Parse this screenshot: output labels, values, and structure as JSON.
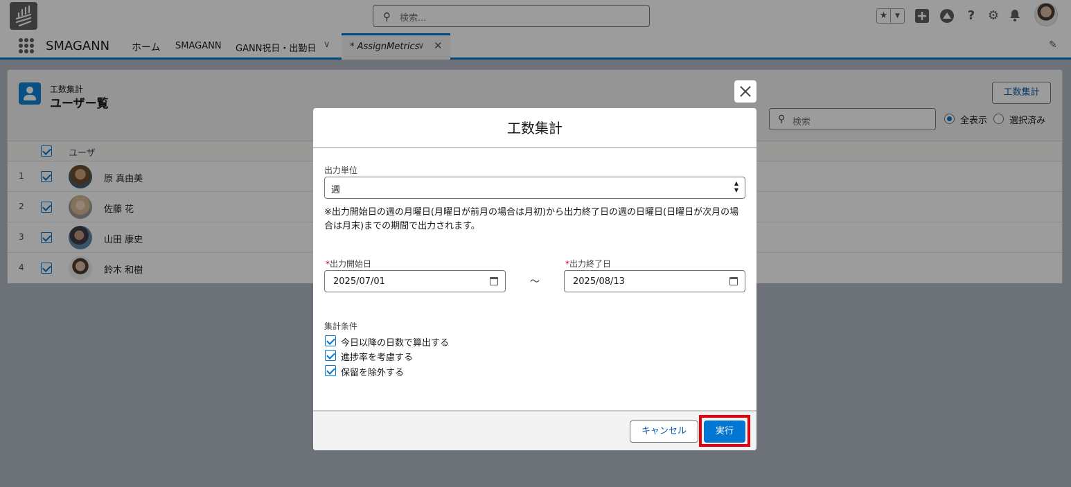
{
  "header": {
    "search_placeholder": "検索..."
  },
  "nav": {
    "app_name": "SMAGANN",
    "items": [
      "ホーム",
      "SMAGANN",
      "GANN祝日・出勤日"
    ],
    "active_tab": "* AssignMetrics"
  },
  "page": {
    "object_label": "工数集計",
    "title": "ユーザー覧",
    "action_button": "工数集計",
    "search_placeholder": "検索",
    "filter_all": "全表示",
    "filter_selected": "選択済み",
    "column_user": "ユーザ",
    "rows": [
      {
        "num": "1",
        "name": "原 真由美"
      },
      {
        "num": "2",
        "name": "佐藤 花"
      },
      {
        "num": "3",
        "name": "山田 康史"
      },
      {
        "num": "4",
        "name": "鈴木 和樹"
      }
    ]
  },
  "modal": {
    "title": "工数集計",
    "unit_label": "出力単位",
    "unit_value": "週",
    "note": "※出力開始日の週の月曜日(月曜日が前月の場合は月初)から出力終了日の週の日曜日(日曜日が次月の場合は月末)までの期間で出力されます。",
    "required_mark": "*",
    "start_label": "出力開始日",
    "start_value": "2025/07/01",
    "end_label": "出力終了日",
    "end_value": "2025/08/13",
    "range_separator": "～",
    "conditions_label": "集計条件",
    "conditions": [
      "今日以降の日数で算出する",
      "進捗率を考慮する",
      "保留を除外する"
    ],
    "cancel_label": "キャンセル",
    "run_label": "実行"
  },
  "colors": {
    "brand": "#0176d3",
    "highlight": "#e8000d"
  }
}
